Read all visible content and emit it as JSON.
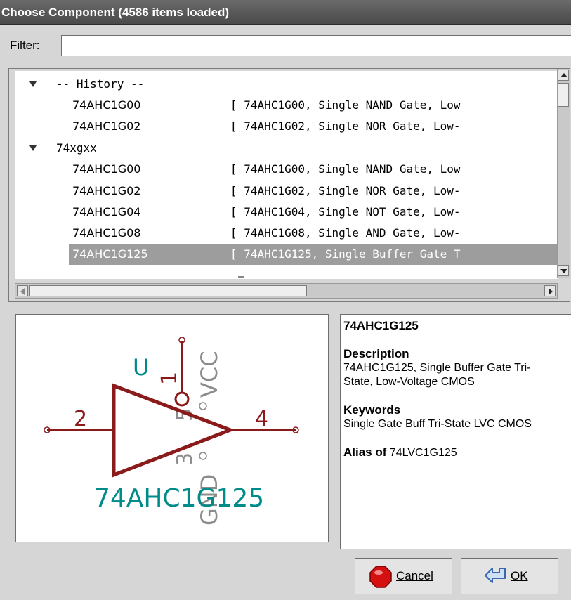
{
  "window": {
    "title": "Choose Component (4586 items loaded)"
  },
  "filter": {
    "label": "Filter:",
    "value": ""
  },
  "tree": {
    "groups": [
      {
        "label": "-- History --",
        "items": [
          {
            "name": "74AHC1G00",
            "desc": "[ 74AHC1G00, Single NAND Gate, Low"
          },
          {
            "name": "74AHC1G02",
            "desc": "[ 74AHC1G02, Single NOR Gate, Low-"
          }
        ]
      },
      {
        "label": "74xgxx",
        "items": [
          {
            "name": "74AHC1G00",
            "desc": "[ 74AHC1G00, Single NAND Gate, Low"
          },
          {
            "name": "74AHC1G02",
            "desc": "[ 74AHC1G02, Single NOR Gate, Low-"
          },
          {
            "name": "74AHC1G04",
            "desc": "[ 74AHC1G04, Single NOT Gate, Low-"
          },
          {
            "name": "74AHC1G08",
            "desc": "[ 74AHC1G08, Single AND Gate, Low-"
          },
          {
            "name": "74AHC1G125",
            "desc": "[ 74AHC1G125, Single Buffer Gate T",
            "selected": true
          }
        ]
      }
    ]
  },
  "symbol": {
    "ref": "U",
    "value": "74AHC1G125",
    "pins": {
      "vcc_num": "1",
      "vcc_name": "VCC",
      "in_num": "2",
      "out_num": "4",
      "gnd_num": "3",
      "gnd_name": "GND",
      "oe_num": "5"
    },
    "colors": {
      "body": "#8b1a1a",
      "ref": "#008b8b",
      "pin_name": "#8c8c8c"
    }
  },
  "info": {
    "name": "74AHC1G125",
    "description_label": "Description",
    "description": "74AHC1G125, Single Buffer Gate Tri-State, Low-Voltage CMOS",
    "keywords_label": "Keywords",
    "keywords": "Single Gate Buff Tri-State LVC CMOS",
    "alias_label": "Alias of",
    "alias": "74LVC1G125"
  },
  "buttons": {
    "cancel": "Cancel",
    "ok": "OK"
  }
}
